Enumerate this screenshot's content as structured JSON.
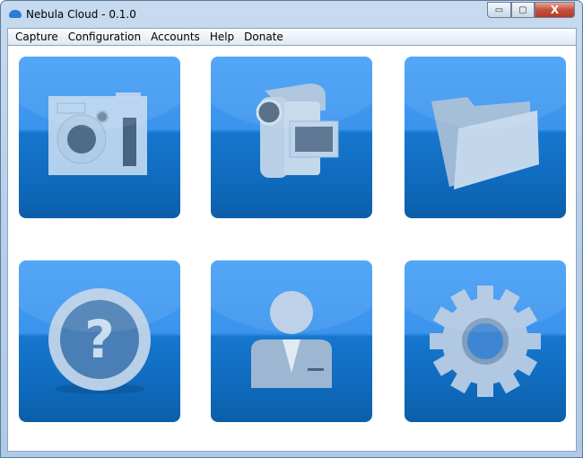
{
  "window": {
    "title": "Nebula Cloud - 0.1.0",
    "controls": {
      "minimize": "▭",
      "maximize": "▢",
      "close": "X"
    }
  },
  "menu": [
    "Capture",
    "Configuration",
    "Accounts",
    "Help",
    "Donate"
  ],
  "tiles": [
    {
      "name": "capture-screenshot"
    },
    {
      "name": "capture-video"
    },
    {
      "name": "files"
    },
    {
      "name": "help"
    },
    {
      "name": "accounts"
    },
    {
      "name": "settings"
    }
  ],
  "colors": {
    "tile_top": "#45a0f8",
    "tile_bottom": "#0c5fa8",
    "icon": "#c6dcf0"
  }
}
